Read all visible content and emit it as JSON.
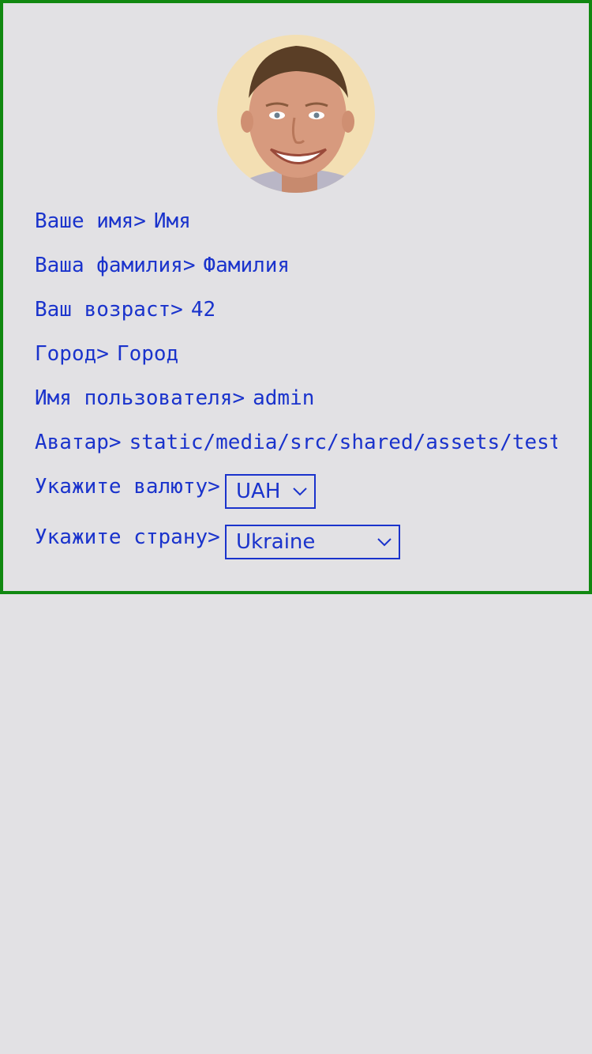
{
  "profile": {
    "first_name": {
      "label": "Ваше имя>",
      "value": "Имя"
    },
    "last_name": {
      "label": "Ваша фамилия>",
      "value": "Фамилия"
    },
    "age": {
      "label": "Ваш возраст>",
      "value": "42"
    },
    "city": {
      "label": "Город>",
      "value": "Город"
    },
    "username": {
      "label": "Имя пользователя>",
      "value": "admin"
    },
    "avatar": {
      "label": "Аватар>",
      "value": "static/media/src/shared/assets/tests"
    },
    "currency": {
      "label": "Укажите валюту>",
      "selected": "UAH"
    },
    "country": {
      "label": "Укажите страну>",
      "selected": "Ukraine"
    }
  },
  "icons": {
    "avatar": "avatar-photo",
    "dropdown": "chevron-down-icon"
  },
  "colors": {
    "text": "#1a33cc",
    "border": "#118811",
    "background": "#e2e1e4"
  }
}
